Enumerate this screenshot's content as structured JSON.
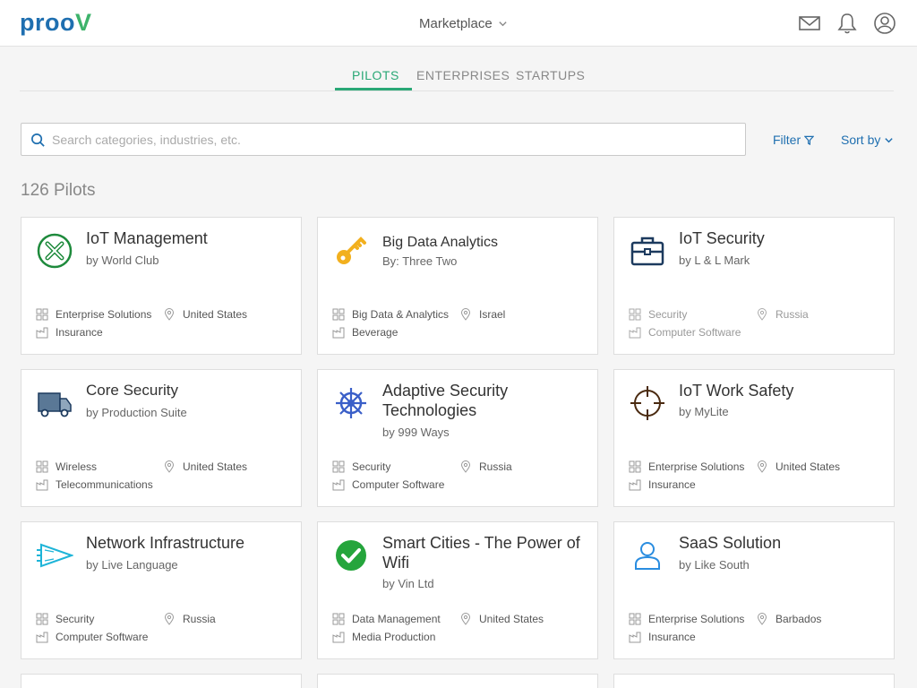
{
  "app": {
    "logo_main": "proo",
    "logo_accent": "V"
  },
  "header": {
    "marketplace_label": "Marketplace"
  },
  "tabs": [
    {
      "label": "PILOTS",
      "active": true
    },
    {
      "label": "ENTERPRISES",
      "active": false
    },
    {
      "label": "STARTUPS",
      "active": false
    }
  ],
  "search": {
    "placeholder": "Search categories, industries, etc.",
    "value": ""
  },
  "controls": {
    "filter_label": "Filter",
    "sort_label": "Sort by"
  },
  "summary": {
    "count_label": "126 Pilots"
  },
  "colors": {
    "accent_green": "#2aa876",
    "link_blue": "#1f6fb0"
  },
  "cards": [
    {
      "title": "IoT Management",
      "by_prefix": "by",
      "by": "World Club",
      "category": "Enterprise Solutions",
      "location": "United States",
      "industry": "Insurance",
      "icon": "x-circle-icon"
    },
    {
      "title": "Big Data Analytics",
      "by_prefix": "By:",
      "by": "Three Two",
      "category": "Big Data & Analytics",
      "location": "Israel",
      "industry": "Beverage",
      "icon": "key-icon"
    },
    {
      "title": "IoT Security",
      "by_prefix": "by",
      "by": "L & L Mark",
      "category": "Security",
      "location": "Russia",
      "industry": "Computer Software",
      "icon": "briefcase-icon"
    },
    {
      "title": "Core Security",
      "by_prefix": "by",
      "by": "Production Suite",
      "category": "Wireless",
      "location": "United States",
      "industry": "Telecommunications",
      "icon": "truck-icon"
    },
    {
      "title": "Adaptive Security Technologies",
      "by_prefix": "by",
      "by": "999 Ways",
      "category": "Security",
      "location": "Russia",
      "industry": "Computer Software",
      "icon": "ship-wheel-icon"
    },
    {
      "title": "IoT Work Safety",
      "by_prefix": "by",
      "by": "MyLite",
      "category": "Enterprise Solutions",
      "location": "United States",
      "industry": "Insurance",
      "icon": "crosshair-icon"
    },
    {
      "title": "Network Infrastructure",
      "by_prefix": "by",
      "by": "Live Language",
      "category": "Security",
      "location": "Russia",
      "industry": "Computer Software",
      "icon": "pennant-icon"
    },
    {
      "title": "Smart Cities - The Power of Wifi",
      "by_prefix": "by",
      "by": "Vin Ltd",
      "category": "Data Management",
      "location": "United States",
      "industry": "Media Production",
      "icon": "check-circle-icon"
    },
    {
      "title": "SaaS Solution",
      "by_prefix": "by",
      "by": "Like South",
      "category": "Enterprise Solutions",
      "location": "Barbados",
      "industry": "Insurance",
      "icon": "user-icon"
    }
  ]
}
